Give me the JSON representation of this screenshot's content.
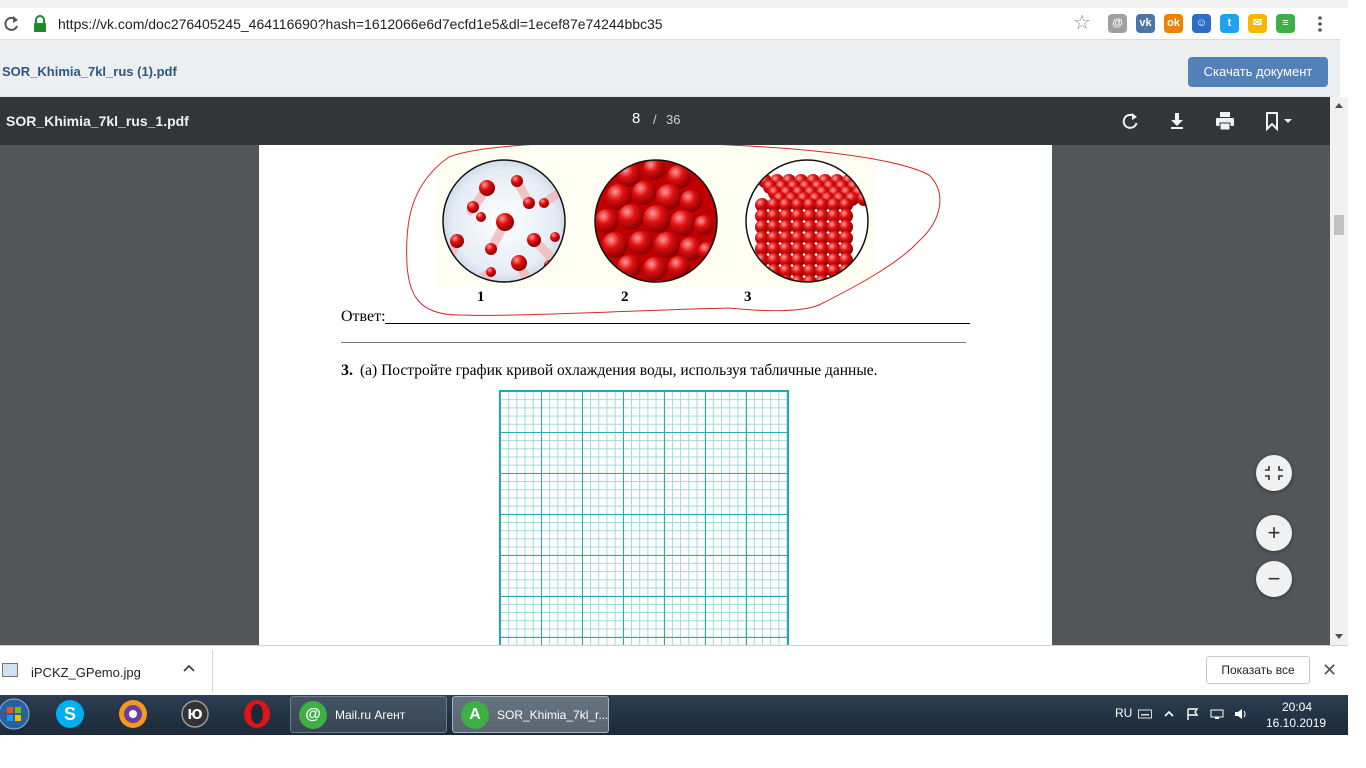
{
  "browser": {
    "url": "https://vk.com/doc276405245_464116690?hash=1612066e6d7ecfd1e5&dl=1ecef87e74244bbc35",
    "extensions": [
      {
        "name": "mail-ru-icon",
        "color": "#a0a0a0",
        "glyph": "@"
      },
      {
        "name": "vk-icon",
        "color": "#4a76a8",
        "glyph": "vk"
      },
      {
        "name": "odnoklassniki-icon",
        "color": "#ee8208",
        "glyph": "ok"
      },
      {
        "name": "mail-agent-icon",
        "color": "#2d6ec9",
        "glyph": "☺"
      },
      {
        "name": "twitter-icon",
        "color": "#1da1f2",
        "glyph": "t"
      },
      {
        "name": "chat-icon",
        "color": "#f5b800",
        "glyph": "✉"
      },
      {
        "name": "list-icon",
        "color": "#3cb043",
        "glyph": "≡"
      }
    ]
  },
  "vk": {
    "file_name": "SOR_Khimia_7kl_rus (1).pdf",
    "download_label": "Скачать документ"
  },
  "pdf": {
    "title": "SOR_Khimia_7kl_rus_1.pdf",
    "page_current": "8",
    "page_sep": "/",
    "page_total": "36",
    "toolbar_icons": [
      "rotate-icon",
      "download-icon",
      "print-icon",
      "bookmark-icon"
    ],
    "zoom_buttons": {
      "fit": "fit-to-page-icon",
      "in": "+",
      "out": "−"
    }
  },
  "page_content": {
    "figure_labels": [
      "1",
      "2",
      "3"
    ],
    "answer_label": "Ответ:",
    "question_number": "3.",
    "question_text": "(a) Постройте график кривой охлаждения воды, используя табличные данные."
  },
  "download_shelf": {
    "file_name": "iPCKZ_GPemo.jpg",
    "show_all": "Показать все"
  },
  "taskbar": {
    "windows": [
      {
        "label": "Mail.ru Агент",
        "icon_color": "#3cb043"
      },
      {
        "label": "SOR_Khimia_7kl_r...",
        "icon_color": "#3cb043"
      }
    ],
    "language": "RU",
    "time": "20:04",
    "date": "16.10.2019"
  }
}
